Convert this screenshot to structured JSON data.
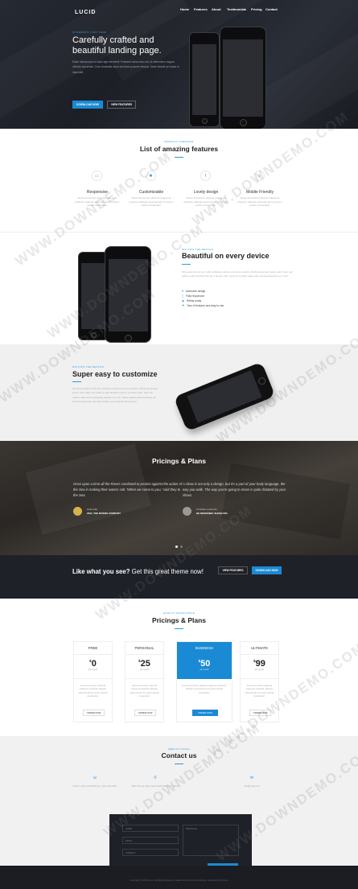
{
  "header": {
    "logo": "LUCID",
    "nav": [
      "Home",
      "Features",
      "About",
      "Testimonials",
      "Pricing",
      "Contact"
    ]
  },
  "hero": {
    "tagline": "DIFFERENTLY BUT SAME",
    "title": "Carefully crafted and beautiful landing page.",
    "text": "Etiam ullamcorper id turpis eget hendrerit. Praesent varius risus vel, et elementum magna ultricies accumsan. Cras venenatis lacus sed diam posuere tempus. Morbi blandit ac neque et imperdiet.",
    "primary_button": "DOWNLOAD NOW",
    "secondary_button": "VIEW FEATURES"
  },
  "features": {
    "tagline": "PRODUCT OVERVIEW",
    "title": "List of amazing features",
    "items": [
      {
        "icon": "monitor-icon",
        "glyph": "▭",
        "title": "Responsive",
        "text": "Fusce fermentum placerat magna ac pharetra. Aliquam euismod elit non ipsum auctor consectetur."
      },
      {
        "icon": "gear-icon",
        "glyph": "✱",
        "title": "Customizable",
        "text": "Fusce fermentum placerat magna ac pharetra. Aliquam euismod elit non ipsum auctor consectetur."
      },
      {
        "icon": "facebook-icon",
        "glyph": "f",
        "title": "Lovely design",
        "text": "Fusce fermentum placerat magna ac pharetra. Aliquam euismod elit non ipsum auctor consectetur."
      },
      {
        "icon": "drop-icon",
        "glyph": "◊",
        "title": "Mobile Friendly",
        "text": "Fusce fermentum placerat magna ac pharetra. Aliquam euismod elit non ipsum auctor consectetur."
      }
    ]
  },
  "beautiful": {
    "tagline": "DIG INTO THE DETAILS",
    "title": "Beautiful on every device",
    "text": "Ohm sed nisi vel sem vidit vulputate cursus a sit amet mauris. Morbi accumsan ipsum velit. Nam nec tellus a odio tincidunt auctor a ornare odio. Sed non mauris vitae erat consequat auctor eu in elit.",
    "list": [
      "Awesome design",
      "Fully responsive",
      "Retina ready",
      "Tons of features and easy to use"
    ]
  },
  "customize": {
    "tagline": "DIG INTO THE DETAILS",
    "title": "Super easy to customize",
    "text": "Quisque pretium velit nec molestie cursus a sit amet mauris. Morbi accumsan ipsum velit. Nam nec tellus a odio tincidunt auctor a ornare odio. Sed non mauris vitae erat consequat auctor eu in elit. Class aptent taciti sociosqu ad litora torquent per conubia nostra, per inceptos himenaeos."
  },
  "testimonials": {
    "title": "Pricings & Plans",
    "quotes": [
      {
        "text": "Once upon a time all the Rivers combined to protest against the action of the Sea in making their waters salt. 'When we come to you,' said they to the Sea.",
        "author": "Hello Dan",
        "role": "CEO, THE RIVERS COMPANY"
      },
      {
        "text": "A show is not only a design, but it's a part of your body language, the way you walk. The way you're going to move is quite dictated by your shoes.",
        "author": "Christian Louboutin",
        "role": "HE DESIGNER, SHOEZ INC."
      }
    ]
  },
  "cta": {
    "text_bold": "Like what you see?",
    "text_rest": " Get this great theme now!",
    "secondary_button": "VIEW FEATURES",
    "primary_button": "DOWNLOAD NOW"
  },
  "pricing": {
    "tagline": "QUALITY SALES PRICE",
    "title": "Pricings & Plans",
    "plans": [
      {
        "name": "FREE",
        "price": "0",
        "per": "per month",
        "text": "Fusce fermentum placerat magna ac pharetra. Aliquam euismod elit non ipsum lacinia consectetur.",
        "button": "ORDER NOW"
      },
      {
        "name": "PERSONAL",
        "price": "25",
        "per": "per month",
        "text": "Fusce fermentum placerat magna ac pharetra. Aliquam euismod elit non ipsum lacinia consectetur.",
        "button": "ORDER NOW"
      },
      {
        "name": "BUSINESS",
        "price": "50",
        "per": "per month",
        "text": "Fusce fermentum placerat magna ac pharetra. Aliquam euismod elit non ipsum lacinia consectetur.",
        "button": "ORDER NOW"
      },
      {
        "name": "ULTIMATE",
        "price": "99",
        "per": "per month",
        "text": "Fusce fermentum placerat magna ac pharetra. Aliquam euismod elit non ipsum lacinia consectetur.",
        "button": "ORDER NOW"
      }
    ]
  },
  "contact": {
    "tagline": "KEEP IN TOUCH",
    "title": "Contact us",
    "items": [
      {
        "icon": "phone-icon",
        "glyph": "☏",
        "text": "Phone: (415) 124-5678 Fax: (415) 123-4567"
      },
      {
        "icon": "location-icon",
        "glyph": "⚲",
        "text": "1907 Wonder Way, Suite 1603 Miami, FL 33133"
      },
      {
        "icon": "mail-icon",
        "glyph": "✉",
        "text": "info@email.com"
      }
    ],
    "form": {
      "name": "NAME",
      "email": "EMAIL",
      "subject": "SUBJECT",
      "message": "MESSAGE",
      "button": "SEND MESSAGE"
    }
  },
  "footer": {
    "text": "Copyright © 2015 Lucid, All Rights Reserved. Made with love by Riverthemes. Designed by Theme"
  },
  "watermark": "WWW.DOWNDEMO.COM",
  "colors": {
    "accent": "#2b9be0",
    "dark": "#1f2128",
    "featured": "#1a8ad4"
  }
}
